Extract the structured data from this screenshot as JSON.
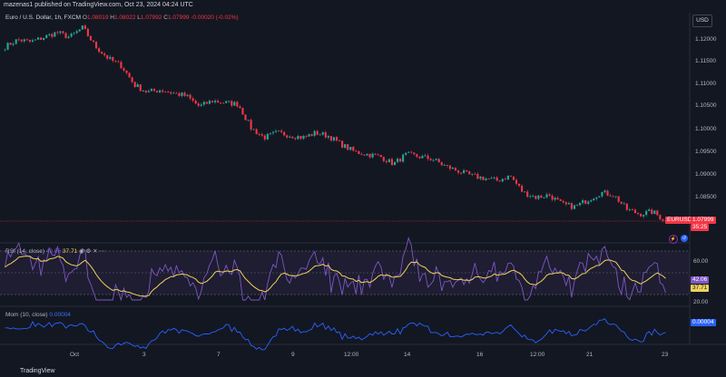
{
  "header": {
    "published": "mazenas1 published on TradingView.com, Oct 23, 2024 04:24 UTC"
  },
  "legend": {
    "symbol": "Euro / U.S. Dollar, 1h, FXCM",
    "open_label": "O",
    "open": "1.08019",
    "high_label": "H",
    "high": "1.08022",
    "low_label": "L",
    "low": "1.07992",
    "close_label": "C",
    "close": "1.07999",
    "change": "-0.00020 (-0.02%)"
  },
  "currency": "USD",
  "price_axis": [
    "1.12000",
    "1.11500",
    "1.11000",
    "1.10500",
    "1.10000",
    "1.09500",
    "1.09000",
    "1.08500"
  ],
  "last_price": {
    "symbol": "EURUSD",
    "value": "1.07999",
    "countdown": "35:25"
  },
  "rsi": {
    "label": "RSI (14, close)",
    "value1": "42.06",
    "value2": "37.71",
    "axis": [
      "60.00",
      "20.00"
    ],
    "box1": "42.06",
    "box2": "37.71"
  },
  "mom": {
    "label": "Mom (10, close)",
    "value": "0.00004",
    "box": "0.00004"
  },
  "time_axis": [
    "Oct",
    "3",
    "7",
    "9",
    "12:00",
    "14",
    "16",
    "12:00",
    "21",
    "23"
  ],
  "footer": {
    "brand": "TradingView"
  },
  "colors": {
    "up": "#26a69a",
    "down": "#f23645",
    "rsi": "#7e57c2",
    "rsi_ma": "#f0d25a",
    "mom": "#2962ff"
  },
  "chart_data": {
    "type": "candlestick",
    "symbol": "EURUSD",
    "interval": "1h",
    "ylim": [
      1.0785,
      1.1225
    ],
    "close_path": [
      1.1165,
      1.118,
      1.1175,
      1.1185,
      1.1195,
      1.1185,
      1.1205,
      1.1165,
      1.114,
      1.1125,
      1.1085,
      1.107,
      1.1075,
      1.1068,
      1.1062,
      1.104,
      1.1052,
      1.1048,
      1.1045,
      1.0995,
      1.0975,
      1.0985,
      1.098,
      1.0975,
      1.0985,
      1.0978,
      1.096,
      1.0945,
      1.094,
      1.0935,
      1.092,
      1.094,
      1.0935,
      1.093,
      1.0915,
      1.0905,
      1.0895,
      1.089,
      1.0885,
      1.0895,
      1.086,
      1.085,
      1.0855,
      1.0835,
      1.083,
      1.0845,
      1.086,
      1.0855,
      1.0825,
      1.0815,
      1.082,
      1.08
    ]
  }
}
